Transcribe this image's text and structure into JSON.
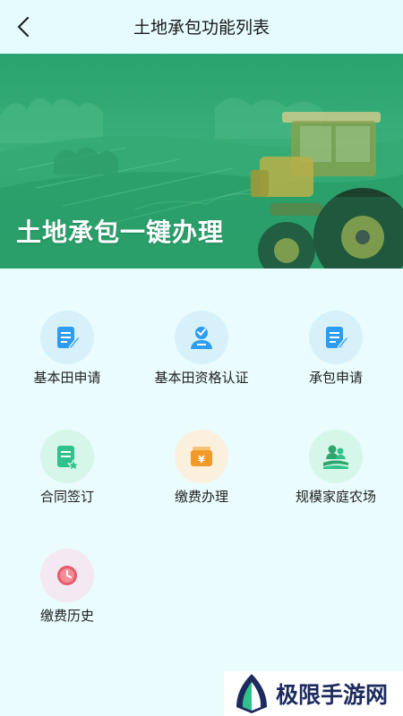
{
  "header": {
    "title": "土地承包功能列表",
    "back_icon": "chevron-left-icon"
  },
  "banner": {
    "text": "土地承包一键办理"
  },
  "menu": [
    {
      "label": "基本田申请",
      "icon": "form-edit-icon"
    },
    {
      "label": "基本田资格认证",
      "icon": "verified-user-icon"
    },
    {
      "label": "承包申请",
      "icon": "form-edit-icon"
    },
    {
      "label": "合同签订",
      "icon": "contract-sign-icon"
    },
    {
      "label": "缴费办理",
      "icon": "payment-yen-icon"
    },
    {
      "label": "规模家庭农场",
      "icon": "family-farm-icon"
    },
    {
      "label": "缴费历史",
      "icon": "clock-history-icon"
    }
  ],
  "watermark": {
    "text": "极限手游网"
  },
  "colors": {
    "banner_green": "#2aa06a",
    "icon_blue": "#2e9cf0",
    "icon_green": "#2fc28a",
    "icon_orange": "#f19a2a",
    "icon_red": "#e85a6a"
  }
}
